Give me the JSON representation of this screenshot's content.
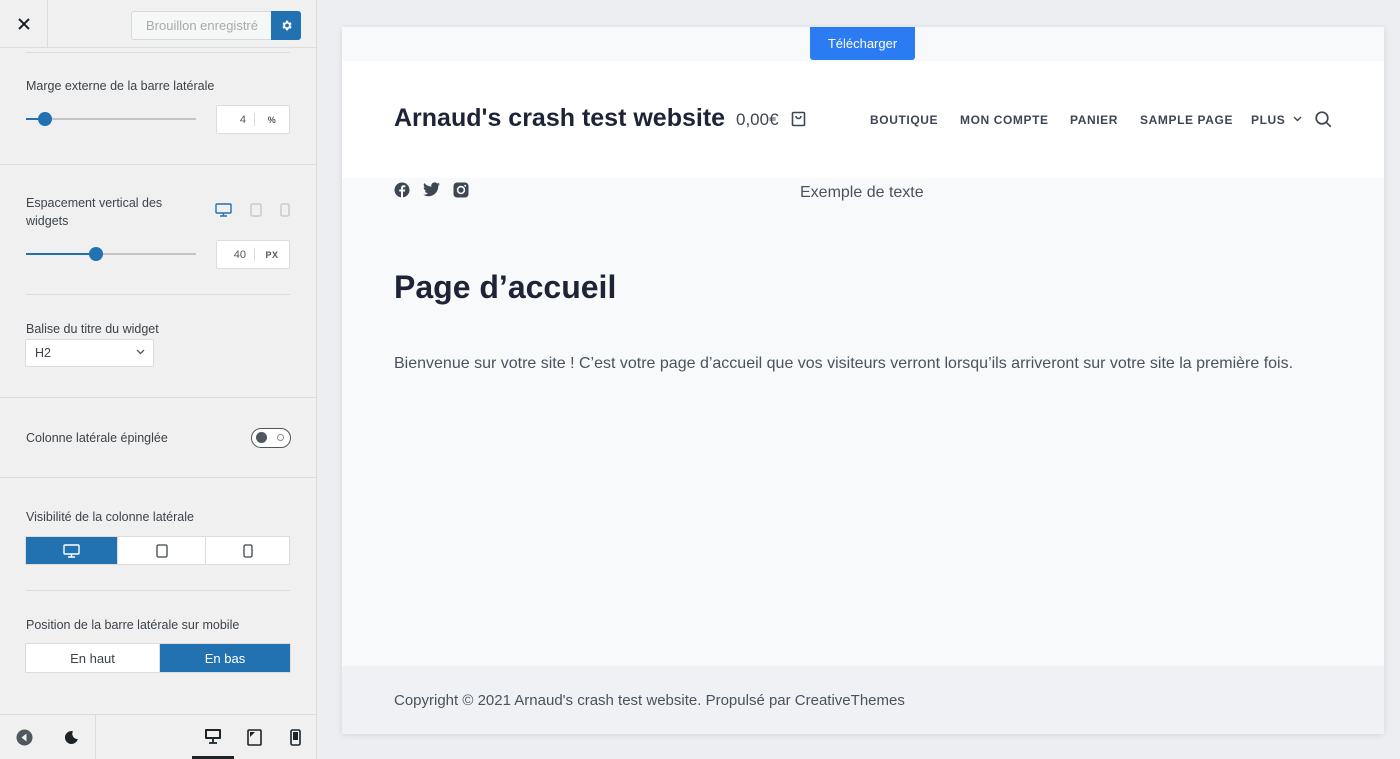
{
  "sidebar": {
    "header": {
      "close_icon": "close-icon",
      "draft_label": "Brouillon enregistré",
      "settings_icon": "gear-icon"
    },
    "sidebar_margin": {
      "label": "Marge externe de la barre latérale",
      "value": "4",
      "unit": "%",
      "slider_fraction": 0.11
    },
    "widget_spacing": {
      "label": "Espacement vertical des widgets",
      "value": "40",
      "unit": "PX",
      "slider_fraction": 0.41,
      "devices": [
        "desktop-icon",
        "tablet-icon",
        "mobile-icon"
      ]
    },
    "widget_title_tag": {
      "label": "Balise du titre du widget",
      "selected": "H2"
    },
    "sticky_sidebar": {
      "label": "Colonne latérale épinglée",
      "enabled": false
    },
    "sidebar_visibility": {
      "label": "Visibilité de la colonne latérale",
      "options": [
        "desktop-icon",
        "tablet-icon",
        "mobile-icon"
      ],
      "active": "desktop-icon"
    },
    "mobile_position": {
      "label": "Position de la barre latérale sur mobile",
      "options": [
        "En haut",
        "En bas"
      ],
      "active": "En bas"
    },
    "footer": {
      "icons": [
        "collapse-icon",
        "dark-mode-icon",
        "desktop-preview-icon",
        "tablet-preview-icon",
        "mobile-preview-icon"
      ],
      "active_preview": "desktop-preview-icon"
    }
  },
  "preview": {
    "download_label": "Télécharger",
    "site_title": "Arnaud's crash test website",
    "cart_total": "0,00€",
    "nav": [
      "BOUTIQUE",
      "MON COMPTE",
      "PANIER",
      "SAMPLE PAGE",
      "PLUS"
    ],
    "social": [
      "facebook-icon",
      "twitter-icon",
      "instagram-icon"
    ],
    "sample_text": "Exemple de texte",
    "page_title": "Page d’accueil",
    "page_body": "Bienvenue sur votre site ! C’est votre page d’accueil que vos visiteurs verront lorsqu’ils arriveront sur votre site la première fois.",
    "copyright": "Copyright © 2021 Arnaud's crash test website. Propulsé par CreativeThemes"
  },
  "colors": {
    "accent": "#2271b1",
    "download_button": "#2b7cf2",
    "sidebar_bg": "#f0f0f1",
    "preview_bg": "#f8f9fb"
  }
}
